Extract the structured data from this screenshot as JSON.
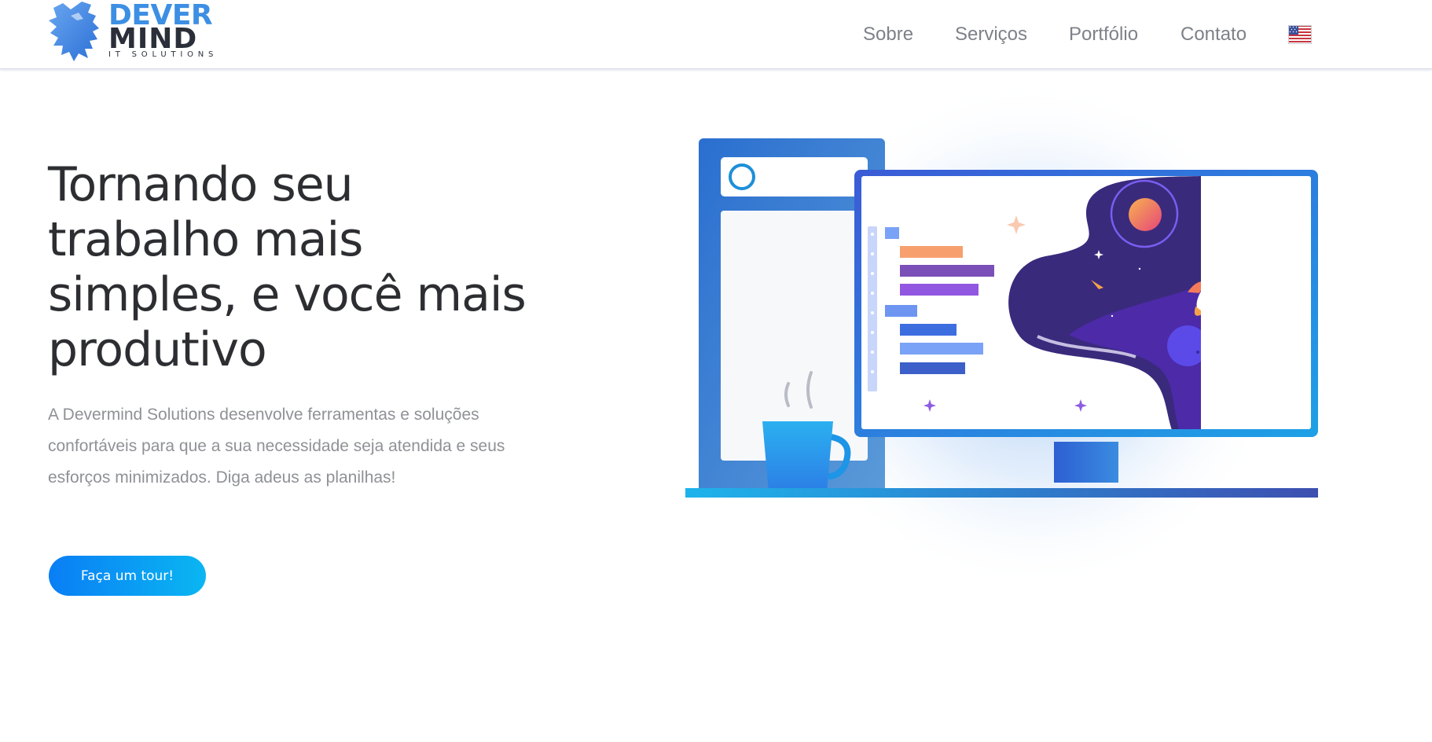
{
  "brand": {
    "logo_line1": "DEVER",
    "logo_line2": "MIND",
    "logo_tagline": "IT SOLUTIONS",
    "primary_color": "#3d8fe3"
  },
  "nav": {
    "items": [
      {
        "label": "Sobre"
      },
      {
        "label": "Serviços"
      },
      {
        "label": "Portfólio"
      },
      {
        "label": "Contato"
      }
    ],
    "language_flag": "us-flag-icon"
  },
  "hero": {
    "title": "Tornando seu trabalho mais simples, e você mais produtivo",
    "description": "A Devermind Solutions desenvolve ferramentas e soluções confortáveis para que a sua necessidade seja atendida e seus esforços minimizados. Diga adeus as planilhas!",
    "cta_label": "Faça um tour!",
    "cta_color": "#0a7ef5"
  },
  "illustration": {
    "name": "desktop-workspace-illustration",
    "accent_colors": [
      "#3a7bd5",
      "#4c2aa8",
      "#f7a06e",
      "#1e9be9"
    ]
  }
}
